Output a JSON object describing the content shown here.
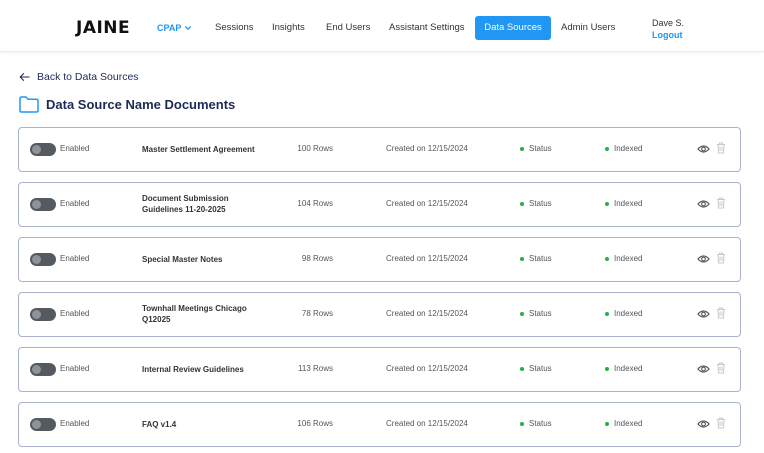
{
  "brand": {
    "logo_text": "JAINE",
    "accent_color": "#2196f3",
    "status_color": "#22b04b"
  },
  "nav": {
    "program": "CPAP",
    "items": [
      "Sessions",
      "Insights",
      "End Users",
      "Assistant Settings",
      "Data Sources",
      "Admin Users"
    ],
    "active": "Data Sources"
  },
  "user": {
    "name": "Dave S.",
    "logout_label": "Logout"
  },
  "back_link": "Back to Data Sources",
  "page_title": "Data Source Name Documents",
  "documents": [
    {
      "enabled_label": "Enabled",
      "name": "Master Settlement Agreement",
      "rows": "100 Rows",
      "created": "Created on 12/15/2024",
      "status": "Status",
      "indexed": "Indexed"
    },
    {
      "enabled_label": "Enabled",
      "name": "Document Submission Guidelines 11-20-2025",
      "rows": "104 Rows",
      "created": "Created on 12/15/2024",
      "status": "Status",
      "indexed": "Indexed"
    },
    {
      "enabled_label": "Enabled",
      "name": "Special Master Notes",
      "rows": "98 Rows",
      "created": "Created on 12/15/2024",
      "status": "Status",
      "indexed": "Indexed"
    },
    {
      "enabled_label": "Enabled",
      "name": "Townhall Meetings Chicago Q12025",
      "rows": "78 Rows",
      "created": "Created on 12/15/2024",
      "status": "Status",
      "indexed": "Indexed"
    },
    {
      "enabled_label": "Enabled",
      "name": "Internal Review Guidelines",
      "rows": "113 Rows",
      "created": "Created on 12/15/2024",
      "status": "Status",
      "indexed": "Indexed"
    },
    {
      "enabled_label": "Enabled",
      "name": "FAQ v1.4",
      "rows": "106 Rows",
      "created": "Created on 12/15/2024",
      "status": "Status",
      "indexed": "Indexed"
    }
  ]
}
